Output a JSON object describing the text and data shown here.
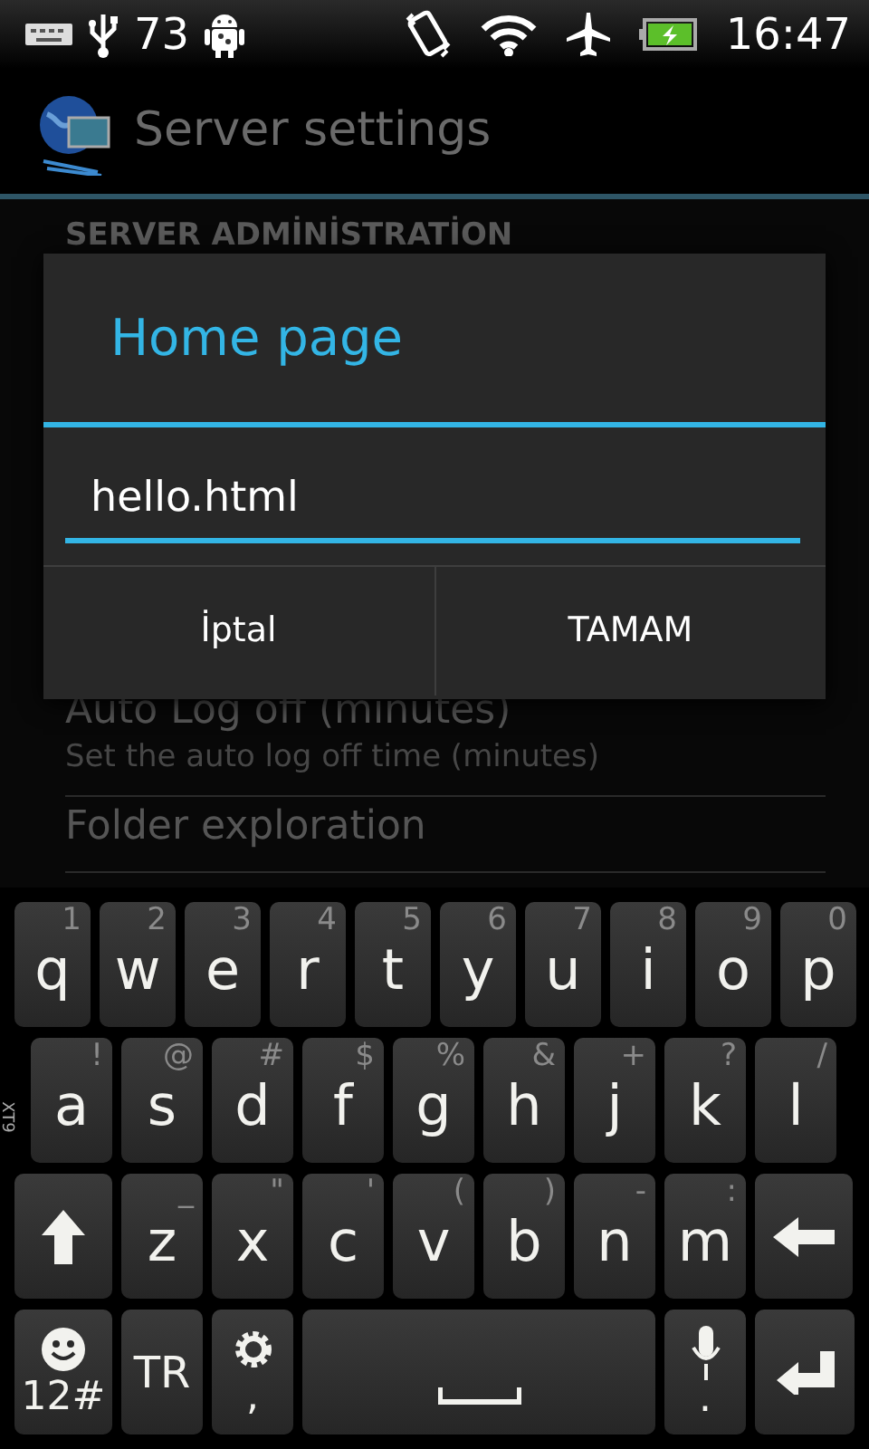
{
  "status_bar": {
    "battery_text": "73",
    "time": "16:47"
  },
  "action_bar": {
    "title": "Server settings"
  },
  "settings": {
    "section_header": "SERVER ADMİNİSTRATİON",
    "items": [
      {
        "title": "Auto Log off (minutes)",
        "summary": "Set the auto log off time (minutes)"
      },
      {
        "title": "Folder exploration"
      }
    ]
  },
  "dialog": {
    "title": "Home page",
    "value": "hello.html",
    "buttons": [
      "İptal",
      "TAMAM"
    ]
  },
  "keyboard": {
    "mode_label": "XT9",
    "key_rows": [
      {
        "keys": [
          {
            "kind": "letter",
            "label": "q",
            "hint": "1"
          },
          {
            "kind": "letter",
            "label": "w",
            "hint": "2"
          },
          {
            "kind": "letter",
            "label": "e",
            "hint": "3"
          },
          {
            "kind": "letter",
            "label": "r",
            "hint": "4"
          },
          {
            "kind": "letter",
            "label": "t",
            "hint": "5"
          },
          {
            "kind": "letter",
            "label": "y",
            "hint": "6"
          },
          {
            "kind": "letter",
            "label": "u",
            "hint": "7"
          },
          {
            "kind": "letter",
            "label": "i",
            "hint": "8"
          },
          {
            "kind": "letter",
            "label": "o",
            "hint": "9"
          },
          {
            "kind": "letter",
            "label": "p",
            "hint": "0"
          }
        ]
      },
      {
        "keys": [
          {
            "kind": "letter",
            "label": "a",
            "hint": "!"
          },
          {
            "kind": "letter",
            "label": "s",
            "hint": "@"
          },
          {
            "kind": "letter",
            "label": "d",
            "hint": "#"
          },
          {
            "kind": "letter",
            "label": "f",
            "hint": "$"
          },
          {
            "kind": "letter",
            "label": "g",
            "hint": "%"
          },
          {
            "kind": "letter",
            "label": "h",
            "hint": "&"
          },
          {
            "kind": "letter",
            "label": "j",
            "hint": "+"
          },
          {
            "kind": "letter",
            "label": "k",
            "hint": "?"
          },
          {
            "kind": "letter",
            "label": "l",
            "hint": "/"
          }
        ]
      },
      {
        "keys": [
          {
            "kind": "shift"
          },
          {
            "kind": "letter",
            "label": "z",
            "hint": "_"
          },
          {
            "kind": "letter",
            "label": "x",
            "hint": "\""
          },
          {
            "kind": "letter",
            "label": "c",
            "hint": "'"
          },
          {
            "kind": "letter",
            "label": "v",
            "hint": "("
          },
          {
            "kind": "letter",
            "label": "b",
            "hint": ")"
          },
          {
            "kind": "letter",
            "label": "n",
            "hint": "-"
          },
          {
            "kind": "letter",
            "label": "m",
            "hint": ":"
          },
          {
            "kind": "backspace"
          }
        ]
      },
      {
        "keys": [
          {
            "kind": "symbols",
            "label": "12#"
          },
          {
            "kind": "lang",
            "label": "TR"
          },
          {
            "kind": "settings",
            "label": ","
          },
          {
            "kind": "space"
          },
          {
            "kind": "mic",
            "label": "."
          },
          {
            "kind": "enter"
          }
        ]
      }
    ]
  }
}
